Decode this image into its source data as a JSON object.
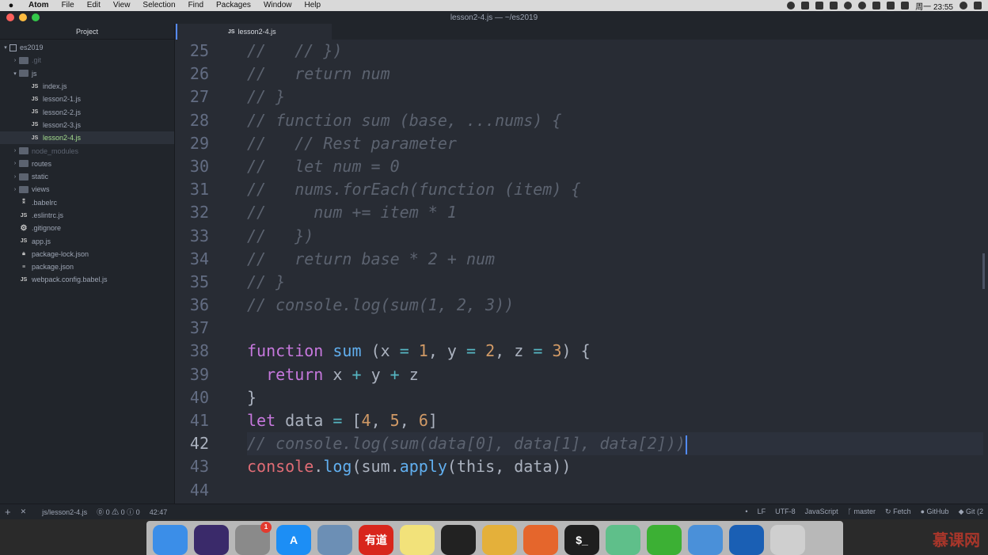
{
  "menubar": {
    "apple": "",
    "items": [
      "Atom",
      "File",
      "Edit",
      "View",
      "Selection",
      "Find",
      "Packages",
      "Window",
      "Help"
    ],
    "clock": "周一 23:55"
  },
  "window": {
    "title": "lesson2-4.js — ~/es2019"
  },
  "tree": {
    "header": "Project",
    "rows": [
      {
        "label": "es2019",
        "icon": "repo",
        "arrow": "▾"
      },
      {
        "label": ".git",
        "icon": "folder",
        "arrow": "›"
      },
      {
        "label": "js",
        "icon": "folder",
        "arrow": "▾"
      },
      {
        "label": "index.js",
        "icon": "JS"
      },
      {
        "label": "lesson2-1.js",
        "icon": "JS"
      },
      {
        "label": "lesson2-2.js",
        "icon": "JS"
      },
      {
        "label": "lesson2-3.js",
        "icon": "JS"
      },
      {
        "label": "lesson2-4.js",
        "icon": "JS"
      },
      {
        "label": "node_modules",
        "icon": "folder",
        "arrow": "›"
      },
      {
        "label": "routes",
        "icon": "folder",
        "arrow": "›"
      },
      {
        "label": "static",
        "icon": "folder",
        "arrow": "›"
      },
      {
        "label": "views",
        "icon": "folder",
        "arrow": "›"
      },
      {
        "label": ".babelrc",
        "icon": "config"
      },
      {
        "label": ".eslintrc.js",
        "icon": "JS"
      },
      {
        "label": ".gitignore",
        "icon": "gear"
      },
      {
        "label": "app.js",
        "icon": "JS"
      },
      {
        "label": "package-lock.json",
        "icon": "lock"
      },
      {
        "label": "package.json",
        "icon": "file"
      },
      {
        "label": "webpack.config.babel.js",
        "icon": "JS"
      }
    ]
  },
  "tab": {
    "icon": "JS",
    "label": "lesson2-4.js"
  },
  "editor": {
    "line_numbers": [
      "25",
      "26",
      "27",
      "28",
      "29",
      "30",
      "31",
      "32",
      "33",
      "34",
      "35",
      "36",
      "37",
      "38",
      "39",
      "40",
      "41",
      "42",
      "43",
      "44"
    ],
    "active_line": "42",
    "lines": {
      "l25": "//   // })",
      "l26": "//   return num",
      "l27": "// }",
      "l28": "// function sum (base, ...nums) {",
      "l29": "//   // Rest parameter",
      "l30": "//   let num = 0",
      "l31": "//   nums.forEach(function (item) {",
      "l32": "//     num += item * 1",
      "l33": "//   })",
      "l34": "//   return base * 2 + num",
      "l35": "// }",
      "l36": "// console.log(sum(1, 2, 3))",
      "l37": "",
      "l42": "// console.log(sum(data[0], data[1], data[2]))",
      "l44": ""
    },
    "tokens": {
      "function": "function",
      "sum": "sum",
      "open": " (",
      "x": "x",
      "eq": "=",
      "one": "1",
      "comma": ", ",
      "y": "y",
      "two": "2",
      "z": "z",
      "three": "3",
      "close_brace_open": ") {",
      "ret_indent": "  ",
      "return": "return",
      "plus": "+",
      "rbrace": "}",
      "let": "let",
      "data": "data",
      "arr_open": "[",
      "four": "4",
      "five": "5",
      "six": "6",
      "arr_close": "]",
      "console": "console",
      "dot": ".",
      "log": "log",
      "paren": "(",
      "apply": "apply",
      "this": "this",
      "close2": "))"
    }
  },
  "statusbar": {
    "add": "+",
    "close": "✕",
    "file": "js/lesson2-4.js",
    "diagnostics": "⓪ 0 ⚠ 0 ⓘ 0",
    "position": "42:47",
    "dot": "•",
    "eol": "LF",
    "encoding": "UTF-8",
    "grammar": "JavaScript",
    "branch": "master",
    "fetch": "Fetch",
    "github": "GitHub",
    "git": "Git (2"
  },
  "dock": {
    "apps": [
      {
        "name": "Finder",
        "color": "#3b8ee8",
        "glyph": ""
      },
      {
        "name": "Siri",
        "color": "#3a2a6a",
        "glyph": ""
      },
      {
        "name": "System Preferences",
        "color": "#8a8a8a",
        "glyph": "",
        "badge": "1"
      },
      {
        "name": "App Store",
        "color": "#1c8ef5",
        "glyph": "A"
      },
      {
        "name": "Preview",
        "color": "#6c8fb5",
        "glyph": ""
      },
      {
        "name": "Youdao",
        "color": "#d8261c",
        "glyph": "有道"
      },
      {
        "name": "Notes",
        "color": "#f2e27a",
        "glyph": ""
      },
      {
        "name": "QQ",
        "color": "#222",
        "glyph": ""
      },
      {
        "name": "Chrome",
        "color": "#e4b03a",
        "glyph": ""
      },
      {
        "name": "Firefox",
        "color": "#e5662c",
        "glyph": ""
      },
      {
        "name": "Terminal",
        "color": "#1e1e1e",
        "glyph": "$_"
      },
      {
        "name": "Atom",
        "color": "#5fbf8a",
        "glyph": ""
      },
      {
        "name": "WeChat",
        "color": "#3cb034",
        "glyph": ""
      },
      {
        "name": "Keynote",
        "color": "#4a90d9",
        "glyph": ""
      },
      {
        "name": "Browser",
        "color": "#1a5fb4",
        "glyph": ""
      },
      {
        "name": "Trash",
        "color": "#cfcfcf",
        "glyph": ""
      }
    ],
    "watermark": "慕课网"
  }
}
